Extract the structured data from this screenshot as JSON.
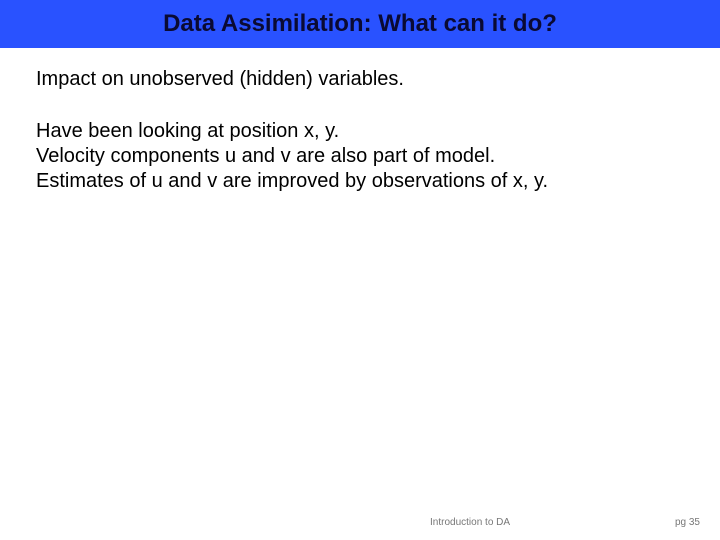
{
  "title": "Data Assimilation: What can it do?",
  "lead": "Impact on unobserved (hidden) variables.",
  "body": [
    "Have been looking at position x, y.",
    "Velocity components u and v are also part of model.",
    "Estimates of u and v are improved by observations of x, y."
  ],
  "footer": {
    "intro": "Introduction to DA",
    "page": "pg 35"
  }
}
